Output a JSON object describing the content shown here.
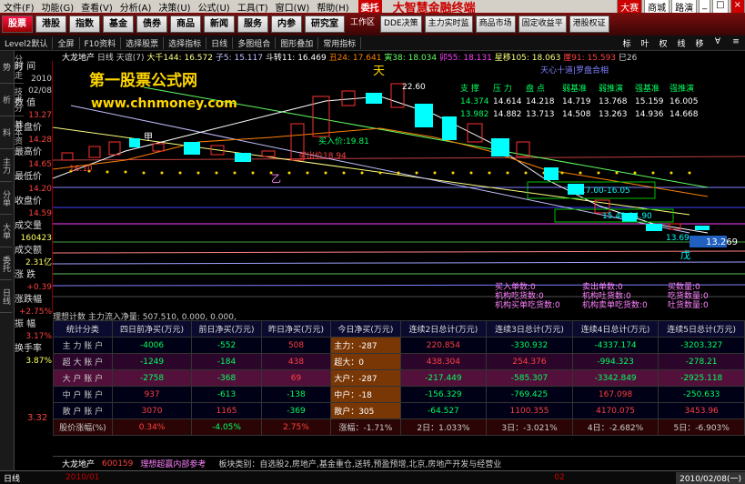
{
  "menu": {
    "items": [
      "文件(F)",
      "功能(G)",
      "查看(V)",
      "分析(A)",
      "决策(U)",
      "公式(U)",
      "工具(T)",
      "窗口(W)",
      "帮助(H)"
    ],
    "weituo": "委托",
    "brand": "大智慧金融终端",
    "right": [
      "大赛",
      "商城",
      "路演"
    ]
  },
  "toolbar": {
    "buttons": [
      "股票",
      "港股",
      "指数",
      "基金",
      "债券",
      "商品",
      "新闻",
      "服务",
      "内参"
    ],
    "active": 0,
    "extra": [
      "研究室",
      "工作区",
      "DDE决策",
      "主力实时监",
      "商品市场",
      "固定收益平",
      "港股权证"
    ]
  },
  "bar2": {
    "items": [
      "Level2默认",
      "全屏",
      "F10资料",
      "选择股票",
      "选择指标",
      "日线",
      "多图组合",
      "图形叠加",
      "常用指标"
    ],
    "right": [
      "标",
      "叶",
      "权",
      "线",
      "移",
      "∀",
      "≡"
    ]
  },
  "lefttabs": [
    "分时走势",
    "技术分析",
    "基本资料",
    "主力",
    "分单",
    "大单",
    "委托",
    "日线"
  ],
  "info": {
    "time_label": "时  间",
    "time": "2010",
    "date": "02/08",
    "num_label": "数  值",
    "num": "13.27",
    "open_label": "开盘价",
    "open": "14.28",
    "high_label": "最高价",
    "high": "14.65",
    "low_label": "最低价",
    "low": "14.20",
    "close_label": "收盘价",
    "close": "14.59",
    "vol_label": "成交量",
    "vol": "160423",
    "amt_label": "成交额",
    "amt": "2.31亿",
    "chg_label": "涨  跌",
    "chg": "+0.39",
    "pct_label": "涨跌幅",
    "pct": "+2.75%",
    "amp_label": "振  幅",
    "amp": "3.17%",
    "turn_label": "换手率",
    "turn": "3.87%",
    "extra": "3.32"
  },
  "chartinfo": {
    "name": "大龙地产",
    "period": "日线",
    "mode": "天谊(7)",
    "items": [
      "大千144: 16.572",
      "子5: 15.117",
      "斗转11: 16.469",
      "丑24: 17.641",
      "寅38: 18.034",
      "卯55: 18.131",
      "星移105: 18.063",
      "厘91: 15.593",
      "巳26"
    ]
  },
  "chart_text": {
    "logo": "第一股票公式网",
    "url": "www.chnmoney.com",
    "tian": "天",
    "price_top": "22.60",
    "label_main": "天心十道|罗盘合相",
    "buy": "买入价:19.81",
    "sell": "买出价18.94",
    "a_mark": "甲",
    "b_mark": "乙",
    "price_left": "16.10",
    "wu": "戊",
    "zone1": "17.00-16.05",
    "zone2": "15.40-14.90",
    "price_13": "13.269",
    "price_low": "13.69",
    "support_headers": [
      "支 撑",
      "压 力",
      "盘 点",
      "弱基准",
      "弱推演",
      "强基准",
      "强推演"
    ],
    "support_row1": [
      "14.374",
      "14.614",
      "14.218",
      "14.719",
      "13.768",
      "15.159",
      "16.005"
    ],
    "support_row2": [
      "13.982",
      "14.882",
      "13.713",
      "14.508",
      "13.263",
      "14.936",
      "14.668"
    ],
    "orders": [
      "买入单数:0",
      "卖出单数:0",
      "买数量:0",
      "机构吃货数:0",
      "机构吐货数:0",
      "吃货数量:0",
      "机构买单吃货数:0",
      "机构卖单吃货数:0",
      "吐货数量:0"
    ]
  },
  "botinfo": "理想计数  主力流入净量: 507.510, 0.000, 0.000,",
  "table": {
    "headers": [
      "统计分类",
      "四日前净买(万元)",
      "前日净买(万元)",
      "昨日净买(万元)",
      "今日净买(万元)",
      "连续2日总计(万元)",
      "连续3日总计(万元)",
      "连续4日总计(万元)",
      "连续5日总计(万元)"
    ],
    "rows": [
      [
        "主 力 账 户",
        "-4006",
        "-552",
        "508",
        "主力：-287",
        "220.854",
        "-330.932",
        "-4337.174",
        "-3203.327"
      ],
      [
        "超 大 账 户",
        "-1249",
        "-184",
        "438",
        "超大：0",
        "438.304",
        "254.376",
        "-994.323",
        "-278.21"
      ],
      [
        "大 户 账 户",
        "-2758",
        "-368",
        "69",
        "大户：-287",
        "-217.449",
        "-585.307",
        "-3342.849",
        "-2925.118"
      ],
      [
        "中 户 账 户",
        "937",
        "-613",
        "-138",
        "中户：-18",
        "-156.329",
        "-769.425",
        "167.098",
        "-250.633"
      ],
      [
        "散 户 账 户",
        "3070",
        "1165",
        "-369",
        "散户：305",
        "-64.527",
        "1100.355",
        "4170.075",
        "3453.96"
      ],
      [
        "股价涨幅(%)",
        "0.34%",
        "-4.05%",
        "2.75%",
        "涨幅：-1.71%",
        "2日：1.033%",
        "3日：-3.021%",
        "4日：-2.682%",
        "5日：-6.903%"
      ]
    ]
  },
  "plate": {
    "name": "大龙地产",
    "code": "600159",
    "tag": "理想超赢内部参考",
    "text": "板块类别：自选股2,房地产,基金重仓,送转,预盈预增,北京,房地产开发与经营业"
  },
  "status": {
    "view": "日线",
    "date_left": "2010/01",
    "mark": "02",
    "date_right": "2010/02/08(一)"
  },
  "colors": {
    "up": "#ff3030",
    "down": "#00ffff",
    "gold": "#ffd700",
    "green": "#00ff60"
  }
}
